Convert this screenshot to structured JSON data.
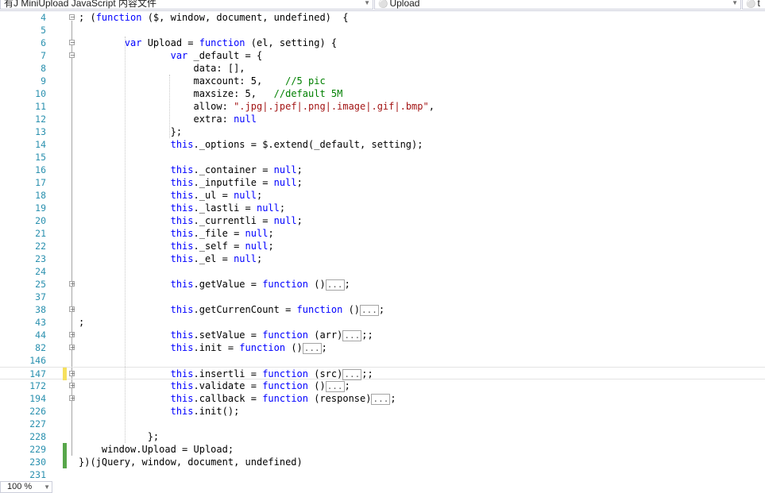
{
  "navbar": {
    "project_combo": "有J MiniUpload JavaScript 内容文件",
    "member_combo": "Upload",
    "extra_combo": "t"
  },
  "zoom": "100 %",
  "lines": [
    {
      "n": "4",
      "fold": "minus",
      "segs": [
        [
          "p",
          "; ("
        ],
        [
          "k",
          "function"
        ],
        [
          "p",
          " ($, window, document, undefined)  {"
        ]
      ]
    },
    {
      "n": "5",
      "segs": []
    },
    {
      "n": "6",
      "fold": "minus",
      "segs": [
        [
          "p",
          "        "
        ],
        [
          "k",
          "var"
        ],
        [
          "p",
          " Upload = "
        ],
        [
          "k",
          "function"
        ],
        [
          "p",
          " (el, setting) {"
        ]
      ]
    },
    {
      "n": "7",
      "fold": "minus",
      "segs": [
        [
          "p",
          "                "
        ],
        [
          "k",
          "var"
        ],
        [
          "p",
          " _default = {"
        ]
      ]
    },
    {
      "n": "8",
      "segs": [
        [
          "p",
          "                    data: [],"
        ]
      ]
    },
    {
      "n": "9",
      "segs": [
        [
          "p",
          "                    maxcount: 5,    "
        ],
        [
          "c",
          "//5 pic"
        ]
      ]
    },
    {
      "n": "10",
      "segs": [
        [
          "p",
          "                    maxsize: 5,   "
        ],
        [
          "c",
          "//default 5M"
        ]
      ]
    },
    {
      "n": "11",
      "segs": [
        [
          "p",
          "                    allow: "
        ],
        [
          "s",
          "\".jpg|.jpef|.png|.image|.gif|.bmp\""
        ],
        [
          "p",
          ","
        ]
      ]
    },
    {
      "n": "12",
      "segs": [
        [
          "p",
          "                    extra: "
        ],
        [
          "k",
          "null"
        ]
      ]
    },
    {
      "n": "13",
      "segs": [
        [
          "p",
          "                };"
        ]
      ]
    },
    {
      "n": "14",
      "segs": [
        [
          "p",
          "                "
        ],
        [
          "k",
          "this"
        ],
        [
          "p",
          "._options = $.extend(_default, setting);"
        ]
      ]
    },
    {
      "n": "15",
      "segs": []
    },
    {
      "n": "16",
      "segs": [
        [
          "p",
          "                "
        ],
        [
          "k",
          "this"
        ],
        [
          "p",
          "._container = "
        ],
        [
          "k",
          "null"
        ],
        [
          "p",
          ";"
        ]
      ]
    },
    {
      "n": "17",
      "segs": [
        [
          "p",
          "                "
        ],
        [
          "k",
          "this"
        ],
        [
          "p",
          "._inputfile = "
        ],
        [
          "k",
          "null"
        ],
        [
          "p",
          ";"
        ]
      ]
    },
    {
      "n": "18",
      "segs": [
        [
          "p",
          "                "
        ],
        [
          "k",
          "this"
        ],
        [
          "p",
          "._ul = "
        ],
        [
          "k",
          "null"
        ],
        [
          "p",
          ";"
        ]
      ]
    },
    {
      "n": "19",
      "segs": [
        [
          "p",
          "                "
        ],
        [
          "k",
          "this"
        ],
        [
          "p",
          "._lastli = "
        ],
        [
          "k",
          "null"
        ],
        [
          "p",
          ";"
        ]
      ]
    },
    {
      "n": "20",
      "segs": [
        [
          "p",
          "                "
        ],
        [
          "k",
          "this"
        ],
        [
          "p",
          "._currentli = "
        ],
        [
          "k",
          "null"
        ],
        [
          "p",
          ";"
        ]
      ]
    },
    {
      "n": "21",
      "segs": [
        [
          "p",
          "                "
        ],
        [
          "k",
          "this"
        ],
        [
          "p",
          "._file = "
        ],
        [
          "k",
          "null"
        ],
        [
          "p",
          ";"
        ]
      ]
    },
    {
      "n": "22",
      "segs": [
        [
          "p",
          "                "
        ],
        [
          "k",
          "this"
        ],
        [
          "p",
          "._self = "
        ],
        [
          "k",
          "null"
        ],
        [
          "p",
          ";"
        ]
      ]
    },
    {
      "n": "23",
      "segs": [
        [
          "p",
          "                "
        ],
        [
          "k",
          "this"
        ],
        [
          "p",
          "._el = "
        ],
        [
          "k",
          "null"
        ],
        [
          "p",
          ";"
        ]
      ]
    },
    {
      "n": "24",
      "segs": []
    },
    {
      "n": "25",
      "fold": "plus",
      "segs": [
        [
          "p",
          "                "
        ],
        [
          "k",
          "this"
        ],
        [
          "p",
          ".getValue = "
        ],
        [
          "k",
          "function"
        ],
        [
          "p",
          " ()"
        ],
        [
          "b",
          "..."
        ],
        [
          "p",
          ";"
        ]
      ]
    },
    {
      "n": "37",
      "segs": []
    },
    {
      "n": "38",
      "fold": "plus",
      "segs": [
        [
          "p",
          "                "
        ],
        [
          "k",
          "this"
        ],
        [
          "p",
          ".getCurrenCount = "
        ],
        [
          "k",
          "function"
        ],
        [
          "p",
          " ()"
        ],
        [
          "b",
          "..."
        ],
        [
          "p",
          ";"
        ]
      ]
    },
    {
      "n": "43",
      "segs": [
        [
          "p",
          ";"
        ]
      ]
    },
    {
      "n": "44",
      "fold": "plus",
      "segs": [
        [
          "p",
          "                "
        ],
        [
          "k",
          "this"
        ],
        [
          "p",
          ".setValue = "
        ],
        [
          "k",
          "function"
        ],
        [
          "p",
          " (arr)"
        ],
        [
          "b",
          "..."
        ],
        [
          "p",
          ";;"
        ]
      ]
    },
    {
      "n": "82",
      "fold": "plus",
      "segs": [
        [
          "p",
          "                "
        ],
        [
          "k",
          "this"
        ],
        [
          "p",
          ".init = "
        ],
        [
          "k",
          "function"
        ],
        [
          "p",
          " ()"
        ],
        [
          "b",
          "..."
        ],
        [
          "p",
          ";"
        ]
      ]
    },
    {
      "n": "146",
      "segs": []
    },
    {
      "n": "147",
      "fold": "plus",
      "mark": "yellow",
      "hl": true,
      "segs": [
        [
          "p",
          "                "
        ],
        [
          "k",
          "this"
        ],
        [
          "p",
          ".insertli = "
        ],
        [
          "k",
          "function"
        ],
        [
          "p",
          " (src)"
        ],
        [
          "b",
          "..."
        ],
        [
          "p",
          ";;"
        ]
      ]
    },
    {
      "n": "172",
      "fold": "plus",
      "segs": [
        [
          "p",
          "                "
        ],
        [
          "k",
          "this"
        ],
        [
          "p",
          ".validate = "
        ],
        [
          "k",
          "function"
        ],
        [
          "p",
          " ()"
        ],
        [
          "b",
          "..."
        ],
        [
          "p",
          ";"
        ]
      ]
    },
    {
      "n": "194",
      "fold": "plus",
      "segs": [
        [
          "p",
          "                "
        ],
        [
          "k",
          "this"
        ],
        [
          "p",
          ".callback = "
        ],
        [
          "k",
          "function"
        ],
        [
          "p",
          " (response)"
        ],
        [
          "b",
          "..."
        ],
        [
          "p",
          ";"
        ]
      ]
    },
    {
      "n": "226",
      "segs": [
        [
          "p",
          "                "
        ],
        [
          "k",
          "this"
        ],
        [
          "p",
          ".init();"
        ]
      ]
    },
    {
      "n": "227",
      "segs": []
    },
    {
      "n": "228",
      "segs": [
        [
          "p",
          "            };"
        ]
      ]
    },
    {
      "n": "229",
      "mark": "green",
      "segs": [
        [
          "p",
          "    window.Upload = Upload;"
        ]
      ]
    },
    {
      "n": "230",
      "mark": "green",
      "segs": [
        [
          "p",
          "})(jQuery, window, document, undefined)"
        ]
      ]
    },
    {
      "n": "231",
      "segs": []
    }
  ],
  "colors": {
    "keyword": "#0000ff",
    "string": "#a31515",
    "comment": "#008000",
    "line_number": "#2b91af",
    "change_saved": "#57a64a",
    "change_unsaved": "#f6e05e"
  }
}
